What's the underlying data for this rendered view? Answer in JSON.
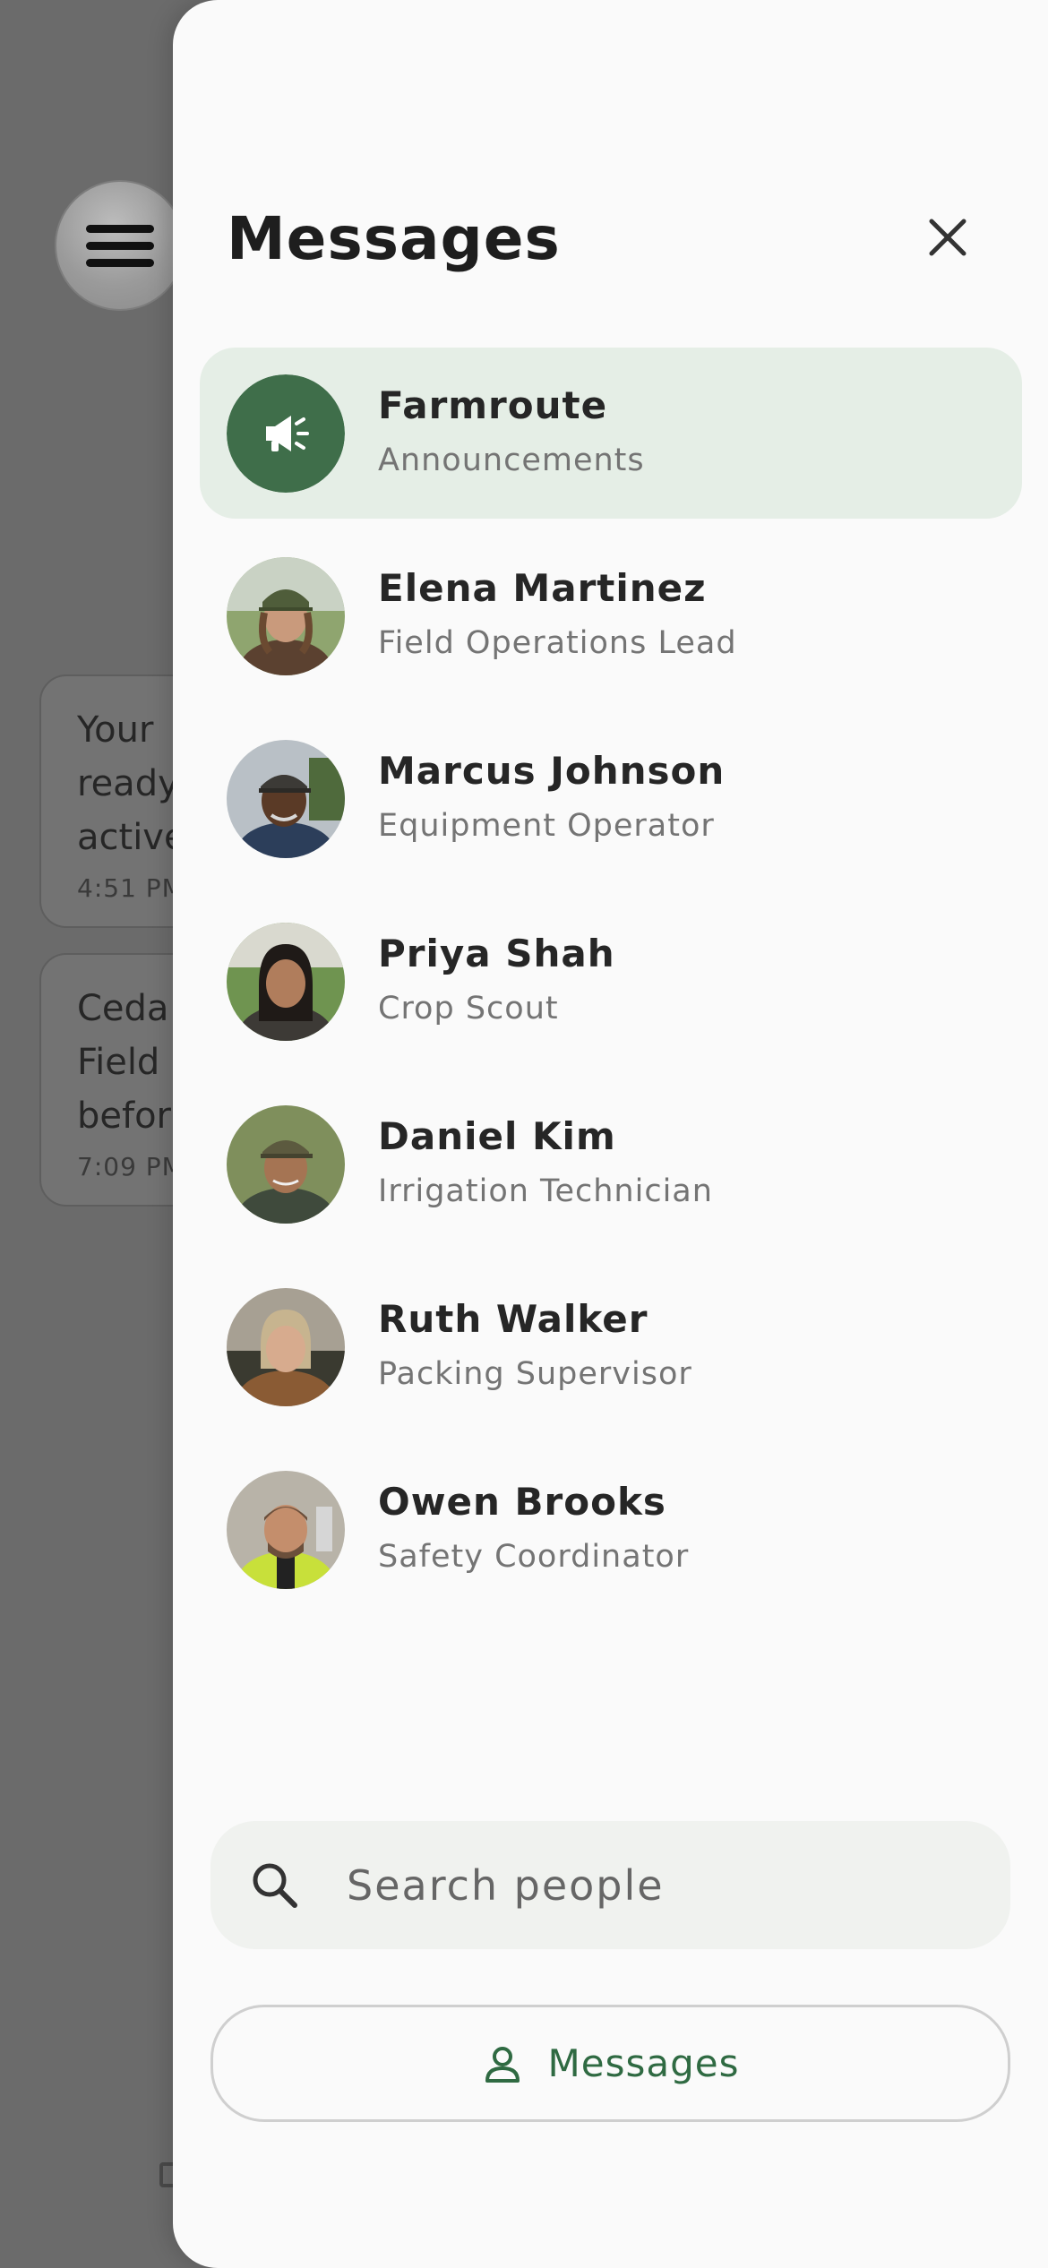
{
  "background": {
    "bubbles": [
      {
        "text": "Your \nready\nactive",
        "time": "4:51 PM"
      },
      {
        "text": "Ceda\nField \nbefor",
        "time": "7:09 PM"
      }
    ]
  },
  "drawer": {
    "title": "Messages",
    "contacts": [
      {
        "name": "Farmroute",
        "role": "Announcements",
        "avatar": "megaphone-icon",
        "active": true
      },
      {
        "name": "Elena Martinez",
        "role": "Field Operations Lead",
        "avatar": "photo"
      },
      {
        "name": "Marcus Johnson",
        "role": "Equipment Operator",
        "avatar": "photo"
      },
      {
        "name": "Priya Shah",
        "role": "Crop Scout",
        "avatar": "photo"
      },
      {
        "name": "Daniel Kim",
        "role": "Irrigation Technician",
        "avatar": "photo"
      },
      {
        "name": "Ruth Walker",
        "role": "Packing Supervisor",
        "avatar": "photo"
      },
      {
        "name": "Owen Brooks",
        "role": "Safety Coordinator",
        "avatar": "photo"
      }
    ],
    "search": {
      "placeholder": "Search people",
      "value": ""
    },
    "messages_button": {
      "label": "Messages",
      "icon": "person-icon"
    }
  },
  "colors": {
    "accent_green": "#3f6e4a",
    "active_row": "#e5eee6",
    "button_text": "#2f6a42"
  }
}
